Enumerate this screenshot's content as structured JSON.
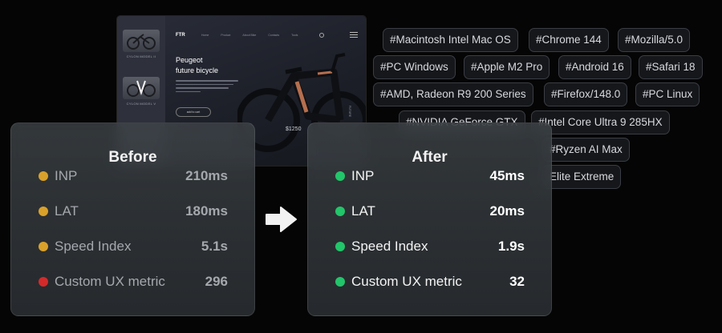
{
  "preview": {
    "logo": "FTR",
    "nav": [
      "Home",
      "Product",
      "About Bike",
      "Contacts",
      "Tools"
    ],
    "title_line1": "Peugeot",
    "title_line2": "future bicycle",
    "button_label": "add to cart",
    "price": "$1250",
    "vertical_label": "FUTURE",
    "thumbs": [
      "CYLON MODEL II",
      "CYLON MODEL V"
    ]
  },
  "tags": [
    "#Macintosh Intel Mac OS",
    "#Chrome 144",
    "#Mozilla/5.0",
    "#PC Windows",
    "#Apple M2 Pro",
    "#Android 16",
    "#Safari 18",
    "#AMD, Radeon R9 200 Series",
    "#Firefox/148.0",
    "#PC Linux",
    "#NVIDIA GeForce GTX",
    "#Intel Core Ultra 9 285HX",
    "#Ryzen AI Max",
    "Elite Extreme"
  ],
  "before": {
    "title": "Before",
    "metrics": [
      {
        "label": "INP",
        "value": "210ms",
        "color": "#d9a12a"
      },
      {
        "label": "LAT",
        "value": "180ms",
        "color": "#d9a12a"
      },
      {
        "label": "Speed Index",
        "value": "5.1s",
        "color": "#d9a12a"
      },
      {
        "label": "Custom UX metric",
        "value": "296",
        "color": "#d42a2a"
      }
    ]
  },
  "after": {
    "title": "After",
    "metrics": [
      {
        "label": "INP",
        "value": "45ms",
        "color": "#22c56a"
      },
      {
        "label": "LAT",
        "value": "20ms",
        "color": "#22c56a"
      },
      {
        "label": "Speed Index",
        "value": "1.9s",
        "color": "#22c56a"
      },
      {
        "label": "Custom UX metric",
        "value": "32",
        "color": "#22c56a"
      }
    ]
  },
  "arrow_icon": "right-arrow-icon"
}
